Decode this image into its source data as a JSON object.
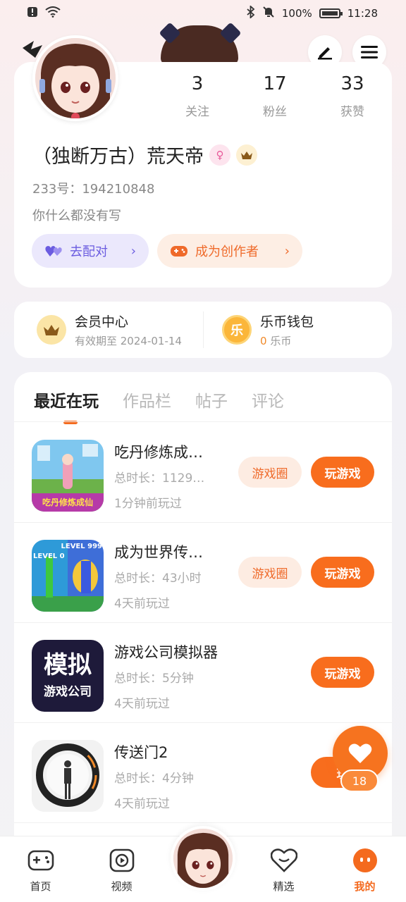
{
  "status_bar": {
    "battery": "100%",
    "time": "11:28"
  },
  "profile": {
    "stats": [
      {
        "num": "3",
        "label": "关注"
      },
      {
        "num": "17",
        "label": "粉丝"
      },
      {
        "num": "33",
        "label": "获赞"
      }
    ],
    "nickname": "（独断万古）荒天帝",
    "uid": "233号：194210848",
    "bio": "你什么都没有写",
    "match_label": "去配对",
    "creator_label": "成为创作者"
  },
  "member": {
    "vip_title": "会员中心",
    "vip_sub": "有效期至 2024-01-14",
    "coin_icon_char": "乐",
    "coin_title": "乐币钱包",
    "coin_amount": "0",
    "coin_unit": "乐币"
  },
  "tabs": [
    "最近在玩",
    "作品栏",
    "帖子",
    "评论"
  ],
  "games": [
    {
      "name": "吃丹修炼成…",
      "duration": "总时长：1129…",
      "last": "1分钟前玩过",
      "circle": "游戏圈",
      "play": "玩游戏"
    },
    {
      "name": "成为世界传…",
      "duration": "总时长：43小时",
      "last": "4天前玩过",
      "circle": "游戏圈",
      "play": "玩游戏"
    },
    {
      "name": "游戏公司模拟器",
      "duration": "总时长：5分钟",
      "last": "4天前玩过",
      "play": "玩游戏",
      "thumb_text": "模拟",
      "thumb_sub": "游戏公司"
    },
    {
      "name": "传送门2",
      "duration": "总时长：4分钟",
      "last": "4天前玩过",
      "play": "玩"
    }
  ],
  "thumb_labels": {
    "game1": "吃丹修炼成仙",
    "game2_a": "LEVEL 0",
    "game2_b": "LEVEL 999"
  },
  "float_like_count": "18",
  "nav": [
    {
      "label": "首页",
      "icon": "gamepad-icon"
    },
    {
      "label": "视频",
      "icon": "video-play-icon"
    },
    {
      "label": "精选",
      "icon": "heart-chat-icon"
    },
    {
      "label": "我的",
      "icon": "smile-face-icon"
    }
  ],
  "colors": {
    "accent": "#f46a1e",
    "purple": "#6b5ce0"
  }
}
